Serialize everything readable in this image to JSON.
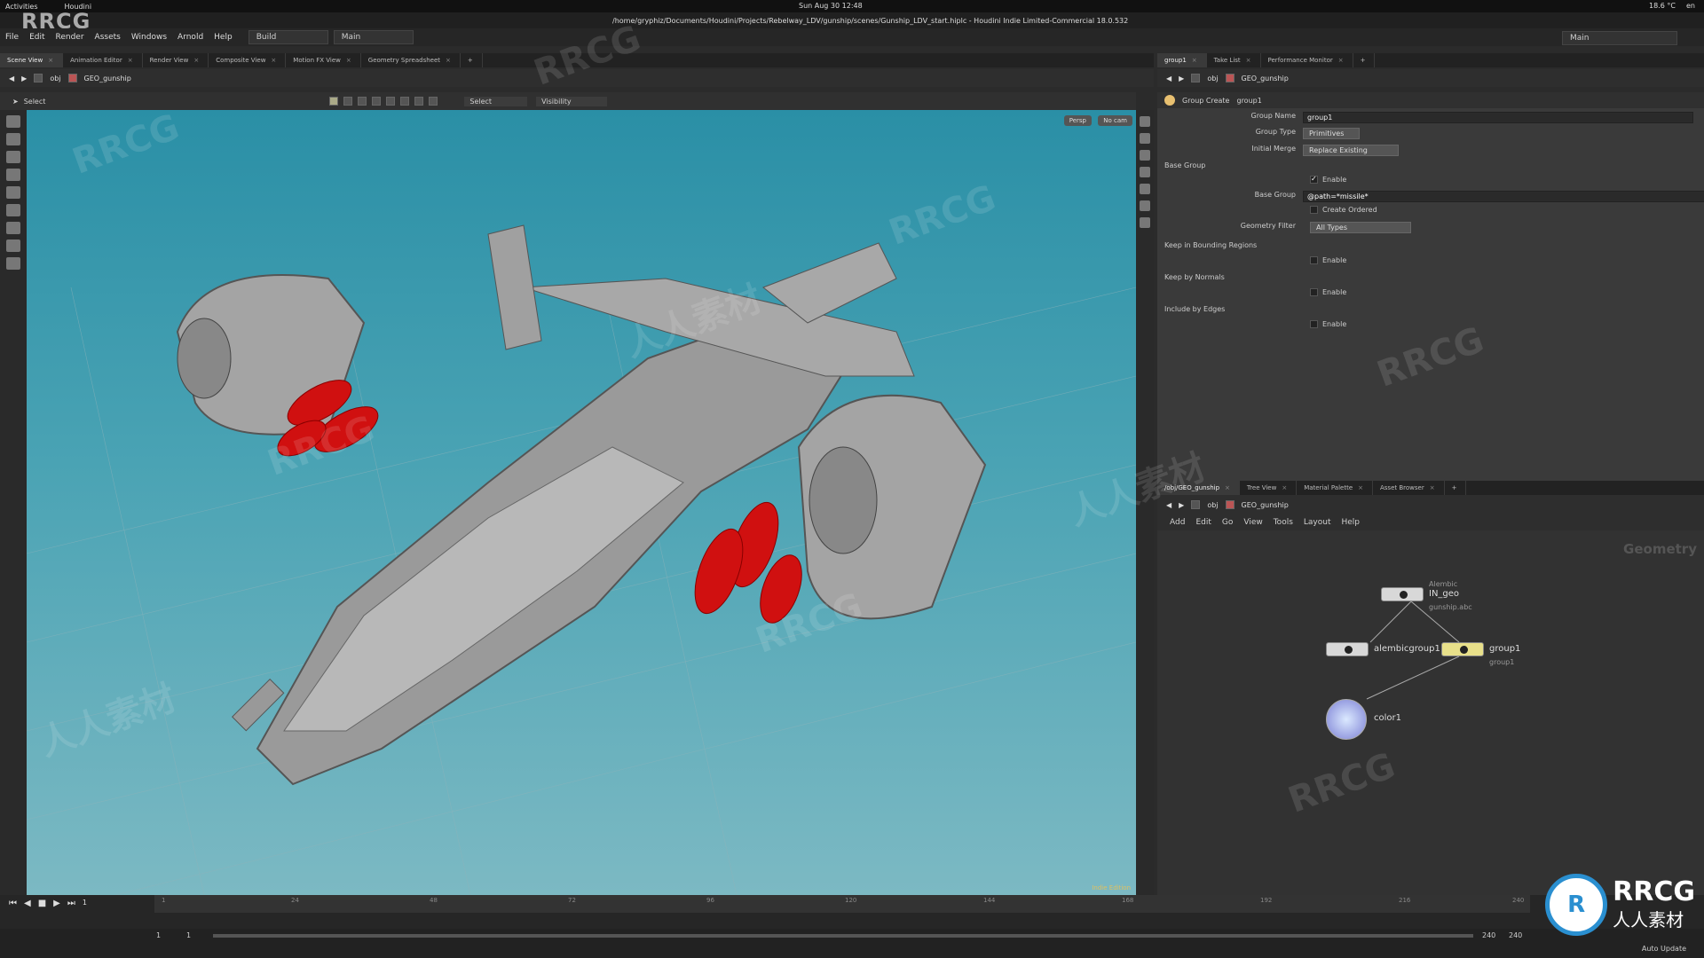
{
  "system": {
    "activities": "Activities",
    "app": "Houdini",
    "datetime": "Sun Aug 30  12:48",
    "temp": "18.6 °C",
    "lang": "en"
  },
  "window": {
    "path": "/home/gryphiz/Documents/Houdini/Projects/Rebelway_LDV/gunship/scenes/Gunship_LDV_start.hiplc - Houdini Indie Limited-Commercial 18.0.532"
  },
  "watermark": {
    "logo": "RRCG",
    "text1": "RRCG",
    "text2": "人人素材",
    "brand_sub": "人人素材"
  },
  "menu": {
    "items": [
      "File",
      "Edit",
      "Render",
      "Assets",
      "Windows",
      "Arnold",
      "Help"
    ],
    "desktop1": "Build",
    "desktop2": "Main",
    "desktop_right": "Main"
  },
  "left_tabs": [
    "Scene View",
    "Animation Editor",
    "Render View",
    "Composite View",
    "Motion FX View",
    "Geometry Spreadsheet"
  ],
  "left_path": {
    "obj": "obj",
    "node": "GEO_gunship"
  },
  "viewport_toolbar": {
    "tool": "Select",
    "select_mode": "Select",
    "visibility": "Visibility"
  },
  "viewport": {
    "persp": "Persp",
    "cam": "No cam",
    "indie": "Indie Edition"
  },
  "right_tabs": [
    "group1",
    "Take List",
    "Performance Monitor"
  ],
  "right_path": {
    "obj": "obj",
    "node": "GEO_gunship"
  },
  "params": {
    "header": "Group Create",
    "node_name": "group1",
    "group_name_label": "Group Name",
    "group_name": "group1",
    "group_type_label": "Group Type",
    "group_type": "Primitives",
    "initial_merge_label": "Initial Merge",
    "initial_merge": "Replace Existing",
    "base_group_section": "Base Group",
    "enable": "Enable",
    "base_group_label": "Base Group",
    "base_group_value": "@path=*missile*",
    "create_ordered": "Create Ordered",
    "geometry_filter_label": "Geometry Filter",
    "geometry_filter": "All Types",
    "bounding_section": "Keep in Bounding Regions",
    "normals_section": "Keep by Normals",
    "edges_section": "Include by Edges"
  },
  "net_tabs": [
    "/obj/GEO_gunship",
    "Tree View",
    "Material Palette",
    "Asset Browser"
  ],
  "net_path": {
    "obj": "obj",
    "node": "GEO_gunship"
  },
  "net_menu": [
    "Add",
    "Edit",
    "Go",
    "View",
    "Tools",
    "Layout",
    "Help"
  ],
  "network": {
    "context": "Geometry",
    "nodes": [
      {
        "name": "IN_geo",
        "sub": "gunship.abc",
        "extra": "Alembic"
      },
      {
        "name": "alembicgroup1",
        "sub": ""
      },
      {
        "name": "group1",
        "sub": "group1"
      },
      {
        "name": "color1",
        "sub": ""
      }
    ]
  },
  "timeline": {
    "ticks": [
      "1",
      "24",
      "48",
      "72",
      "96",
      "120",
      "144",
      "168",
      "192",
      "216",
      "240"
    ],
    "frame": "1",
    "start": "1",
    "start2": "1",
    "end": "240",
    "end2": "240",
    "auto_update": "Auto Update"
  }
}
